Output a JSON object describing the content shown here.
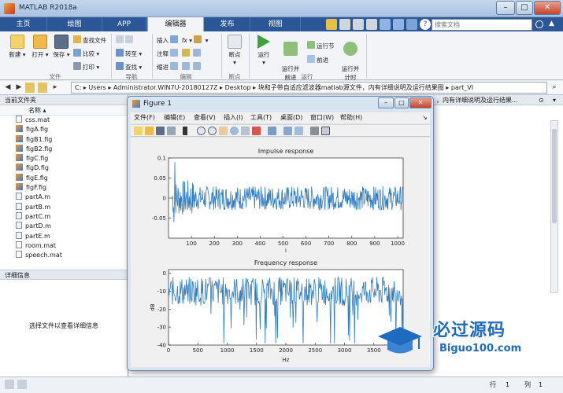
{
  "window": {
    "title": "MATLAB R2018a"
  },
  "ribbon_tabs": [
    "主页",
    "绘图",
    "APP",
    "编辑器",
    "发布",
    "视图"
  ],
  "active_tab": "编辑器",
  "search": {
    "placeholder": "搜索文档"
  },
  "ribbon": {
    "file": {
      "new": "新建",
      "open": "打开",
      "save": "保存",
      "find_files": "查找文件",
      "compare": "比较",
      "print": "打印",
      "group": "文件"
    },
    "navigate": {
      "goto": "转至",
      "find": "查找",
      "group": "导航"
    },
    "edit": {
      "insert": "插入",
      "comment": "注释",
      "indent": "缩进",
      "fx": "fx",
      "group": "编辑"
    },
    "breakpoints": {
      "label": "断点",
      "group": "断点"
    },
    "run": {
      "run": "运行",
      "run_advance": "运行并\n前进",
      "run_section": "运行节",
      "advance": "前进",
      "run_time": "运行并\n计时",
      "group": "运行"
    }
  },
  "address": {
    "path": "C: ▸ Users ▸ Administrator.WIN7U-20180127Z ▸ Desktop ▸ 块和子带自适应滤波器matlab源文件，内有详细说明及运行结果图 ▸ part_VI"
  },
  "left_panel": {
    "header": "当前文件夹",
    "column": "名称 ▴",
    "files": [
      {
        "name": "css.mat",
        "type": "mat"
      },
      {
        "name": "figA.fig",
        "type": "fig"
      },
      {
        "name": "figB1.fig",
        "type": "fig"
      },
      {
        "name": "figB2.fig",
        "type": "fig"
      },
      {
        "name": "figC.fig",
        "type": "fig"
      },
      {
        "name": "figD.fig",
        "type": "fig"
      },
      {
        "name": "figE.fig",
        "type": "fig"
      },
      {
        "name": "figF.fig",
        "type": "fig"
      },
      {
        "name": "partA.m",
        "type": "m"
      },
      {
        "name": "partB.m",
        "type": "m"
      },
      {
        "name": "partC.m",
        "type": "m"
      },
      {
        "name": "partD.m",
        "type": "m"
      },
      {
        "name": "partE.m",
        "type": "m"
      },
      {
        "name": "room.mat",
        "type": "mat"
      },
      {
        "name": "speech.mat",
        "type": "mat"
      }
    ],
    "details_header": "详细信息",
    "details_message": "选择文件以查看详细信息"
  },
  "workspace_header_tail": "，内有详细说明及运行结果...",
  "figure": {
    "title": "Figure 1",
    "menu": [
      "文件(F)",
      "编辑(E)",
      "查看(V)",
      "插入(I)",
      "工具(T)",
      "桌面(D)",
      "窗口(W)",
      "帮助(H)"
    ],
    "plot1": {
      "title": "Impulse response",
      "xlabel": "i",
      "xticks": [
        "100",
        "200",
        "300",
        "400",
        "500",
        "600",
        "700",
        "800",
        "900",
        "1000"
      ],
      "yticks": [
        "0.1",
        "0.05",
        "0",
        "-0.05"
      ]
    },
    "plot2": {
      "title": "Frequency response",
      "xlabel": "Hz",
      "ylabel": "dB",
      "xticks": [
        "0",
        "500",
        "1000",
        "1500",
        "2000",
        "2500",
        "3000",
        "3500"
      ],
      "yticks": [
        "0",
        "-10",
        "-20",
        "-30",
        "-40"
      ]
    }
  },
  "chart_data": [
    {
      "type": "line",
      "title": "Impulse response",
      "xlabel": "i",
      "ylabel": "",
      "xlim": [
        0,
        1024
      ],
      "ylim": [
        -0.1,
        0.1
      ],
      "series": [
        {
          "values_description_note": "",
          "color": "#2f7cc2"
        }
      ],
      "highlights": {
        "peak_x": 30,
        "peak_y": 0.09
      }
    },
    {
      "type": "line",
      "title": "Frequency response",
      "xlabel": "Hz",
      "ylabel": "dB",
      "xlim": [
        0,
        4000
      ],
      "ylim": [
        -40,
        2
      ],
      "series": [
        {
          "color": "#2f7cc2"
        }
      ]
    }
  ],
  "status": {
    "row_label": "行",
    "row": "1",
    "col_label": "列",
    "col": "1"
  },
  "watermark": {
    "main": "必过源码",
    "sub": "Biguo100.com"
  },
  "colors": {
    "tab_bar": "#2b5797",
    "plot_line": "#2f7cc2",
    "watermark": "#1f6bbf"
  }
}
